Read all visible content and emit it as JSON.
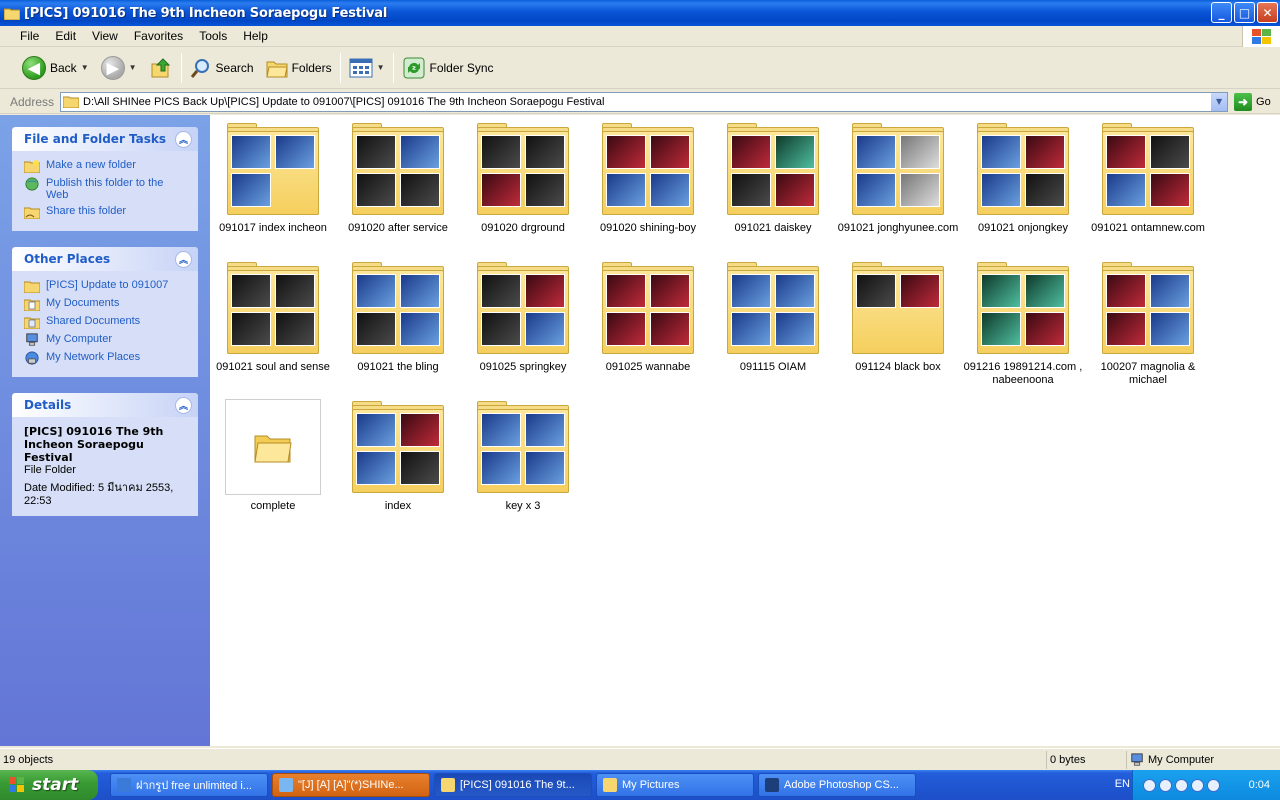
{
  "window": {
    "title": "[PICS] 091016 The 9th Incheon Soraepogu Festival",
    "buttons": {
      "minimize": "_",
      "maximize": "□",
      "close": "✕"
    }
  },
  "menu": [
    "File",
    "Edit",
    "View",
    "Favorites",
    "Tools",
    "Help"
  ],
  "toolbar": {
    "back_label": "Back",
    "search_label": "Search",
    "folders_label": "Folders",
    "foldersync_label": "Folder Sync"
  },
  "address": {
    "label": "Address",
    "value": "D:\\All SHINee PICS Back Up\\[PICS] Update to 091007\\[PICS] 091016 The 9th Incheon Soraepogu Festival",
    "go_label": "Go"
  },
  "sidebar": {
    "file_tasks": {
      "title": "File and Folder Tasks",
      "items": [
        "Make a new folder",
        "Publish this folder to the Web",
        "Share this folder"
      ]
    },
    "other_places": {
      "title": "Other Places",
      "items": [
        "[PICS] Update to 091007",
        "My Documents",
        "Shared Documents",
        "My Computer",
        "My Network Places"
      ]
    },
    "details": {
      "title": "Details",
      "name": "[PICS] 091016 The 9th Incheon Soraepogu Festival",
      "type": "File Folder",
      "modified": "Date Modified: 5 มีนาคม 2553, 22:53"
    }
  },
  "folders": [
    {
      "name": "091017 index incheon"
    },
    {
      "name": "091020 after service"
    },
    {
      "name": "091020 drground"
    },
    {
      "name": "091020 shining-boy"
    },
    {
      "name": "091021 daiskey"
    },
    {
      "name": "091021 jonghyunee.com"
    },
    {
      "name": "091021 onjongkey"
    },
    {
      "name": "091021 ontamnew.com"
    },
    {
      "name": "091021 soul and sense"
    },
    {
      "name": "091021 the bling"
    },
    {
      "name": "091025 springkey"
    },
    {
      "name": "091025 wannabe"
    },
    {
      "name": "091115 OIAM"
    },
    {
      "name": "091124 black box"
    },
    {
      "name": "091216 19891214.com , nabeenoona"
    },
    {
      "name": "100207 magnolia & michael"
    },
    {
      "name": "complete"
    },
    {
      "name": "index"
    },
    {
      "name": "key x 3"
    }
  ],
  "status": {
    "objects": "19 objects",
    "size": "0 bytes",
    "location": "My Computer"
  },
  "taskbar": {
    "start_label": "start",
    "tasks": [
      "ฝากรูป free unlimited i...",
      "\"[J] [A] [A]\"(*)SHINe...",
      "[PICS] 091016 The 9t...",
      "My Pictures",
      "Adobe Photoshop CS..."
    ],
    "language": "EN",
    "clock": "0:04"
  }
}
